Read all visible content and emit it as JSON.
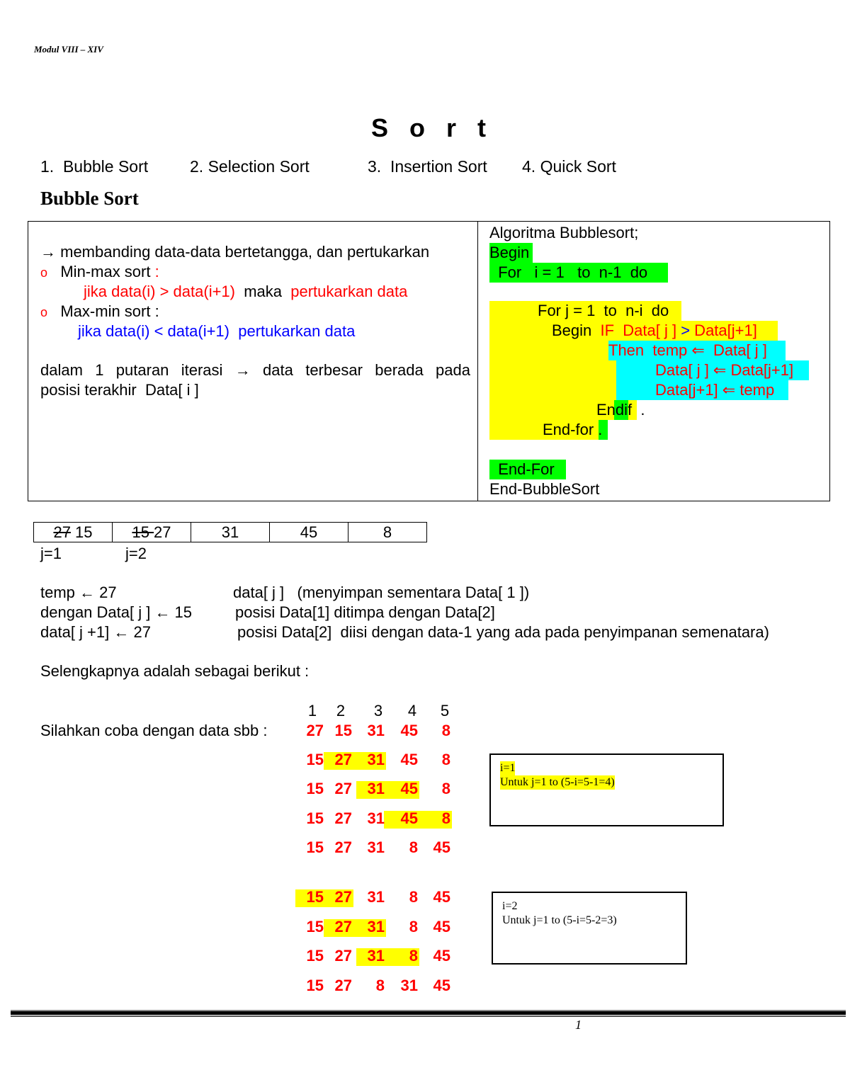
{
  "header": {
    "running_title": "Modul VIII – XIV"
  },
  "title": "S o r t",
  "toc": [
    {
      "label": "1.  Bubble Sort"
    },
    {
      "label": "2. Selection Sort"
    },
    {
      "label": "3.  Insertion Sort"
    },
    {
      "label": "4. Quick Sort"
    }
  ],
  "section_title": "Bubble Sort",
  "explanation": {
    "intro_arrow": "→",
    "intro": "membanding data-data bertetangga, dan pertukarkan",
    "bullet_glyph": "o",
    "minmax_label": "Min-max sort",
    "minmax_colon": " :",
    "minmax_cond": "jika data(i) > data(i+1)",
    "minmax_maka": "  maka  ",
    "minmax_action": "pertukarkan data",
    "maxmin_label": "Max-min sort :",
    "maxmin_rule": "jika data(i) < data(i+1)  pertukarkan data",
    "summary_line1": "dalam 1 putaran iterasi → data terbesar berada pada",
    "summary_line2": "posisi terakhir  Data[ i ]"
  },
  "algorithm": {
    "title": "Algoritma Bubblesort;",
    "begin": "Begin",
    "for_i": "  For   i = 1   to  n-1  do",
    "for_j": "For j = 1  to  n-i  do",
    "begin_if_prefix": "Begin  ",
    "if_cond_a": "IF  Data[ j ] ",
    "if_gt": ">",
    "if_cond_b": " Data[j+1]",
    "then_line": "Then  temp ⇐  Data[ j ]",
    "swap1": "Data[ j ] ⇐ Data[j+1]",
    "swap2": "Data[j+1] ⇐ temp",
    "endif": "Endif",
    "endif_dot": "  .",
    "endfor_inner": "End-for",
    "endfor_inner_dot": " .",
    "endfor_outer": "  End-For",
    "end": "End-BubbleSort"
  },
  "array_example": {
    "cells": [
      {
        "struck": "27",
        "value": " 15"
      },
      {
        "struck": "15 ",
        "value": " 27"
      },
      {
        "struck": "",
        "value": "31"
      },
      {
        "struck": "",
        "value": "45"
      },
      {
        "struck": "",
        "value": "8"
      }
    ],
    "labels": [
      "j=1",
      "j=2"
    ]
  },
  "swap_steps": [
    {
      "left": "temp ← 27",
      "right": "data[ j ]   (menyimpan sementara Data[ 1 ])"
    },
    {
      "left": "dengan Data[ j ] ← 15",
      "right": "posisi Data[1] ditimpa dengan Data[2]"
    },
    {
      "left": "data[ j +1] ← 27",
      "right": "posisi Data[2]  diisi dengan data-1 yang ada pada penyimpanan semenatara)"
    }
  ],
  "continue_text": "Selengkapnya adalah sebagai berikut :",
  "trial_label": "Silahkan coba dengan data sbb :",
  "column_headers": [
    "1",
    "2",
    "3",
    "4",
    "5"
  ],
  "highlight_color": "#ffff00",
  "rows_i1": [
    {
      "values": [
        "27",
        "15",
        "31",
        "45",
        "8"
      ],
      "highlight": []
    },
    {
      "values": [
        "15",
        "27",
        "31",
        "45",
        "8"
      ],
      "highlight": [
        1,
        2
      ]
    },
    {
      "values": [
        "15",
        "27",
        "31",
        "45",
        "8"
      ],
      "highlight": [
        2,
        3
      ]
    },
    {
      "values": [
        "15",
        "27",
        "31",
        "45",
        "8"
      ],
      "highlight": [
        3,
        4
      ]
    },
    {
      "values": [
        "15",
        "27",
        "31",
        "8",
        "45"
      ],
      "highlight": []
    }
  ],
  "rows_i2": [
    {
      "values": [
        "15",
        "27",
        "31",
        "8",
        "45"
      ],
      "highlight": [
        0,
        1
      ]
    },
    {
      "values": [
        "15",
        "27",
        "31",
        "8",
        "45"
      ],
      "highlight": [
        1,
        2
      ]
    },
    {
      "values": [
        "15",
        "27",
        "31",
        "8",
        "45"
      ],
      "highlight": [
        2,
        3
      ]
    },
    {
      "values": [
        "15",
        "27",
        "8",
        "31",
        "45"
      ],
      "highlight": []
    }
  ],
  "notes": [
    {
      "line1": "i=1",
      "line2": "Untuk j=1 to  (5-i=5-1=4)"
    },
    {
      "line1": "i=2",
      "line2": "Untuk j=1 to  (5-i=5-2=3)"
    }
  ],
  "page_number": "1"
}
